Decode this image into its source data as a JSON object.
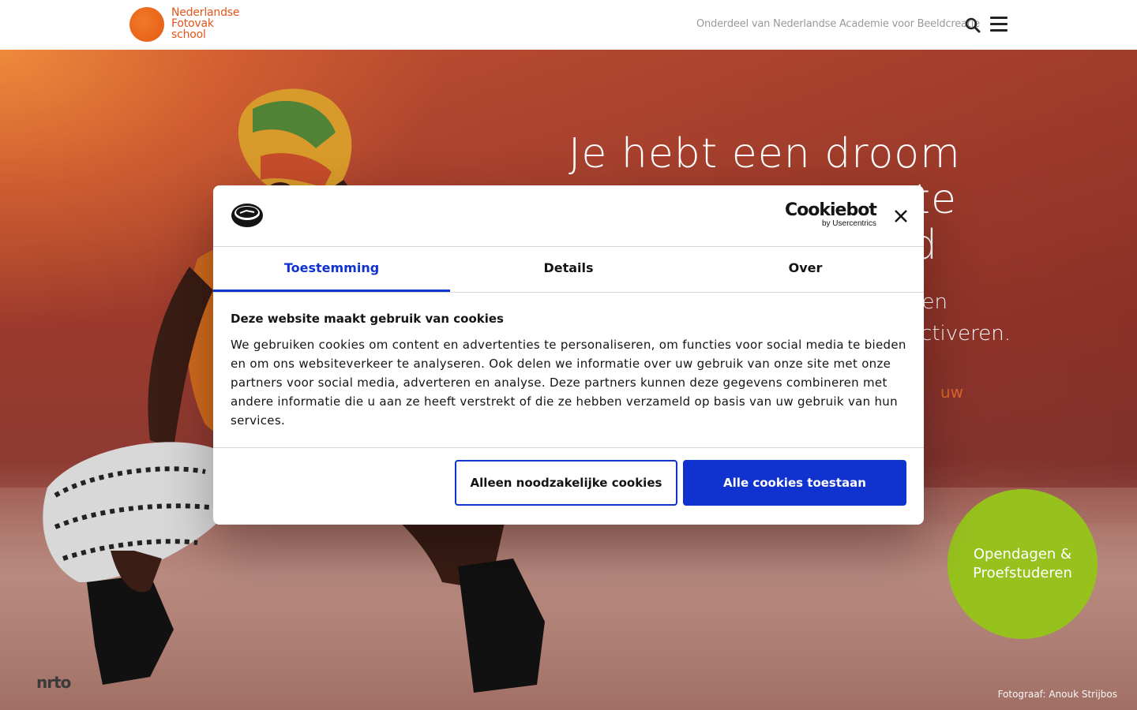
{
  "header": {
    "logo_lines": [
      "Nederlandse",
      "Fotovak",
      "school"
    ],
    "tagline": "Onderdeel van Nederlandse Academie voor Beeldcreatie",
    "search_icon": "search-icon",
    "menu_icon": "hamburger-menu-icon"
  },
  "hero": {
    "title_lines": [
      "Je hebt een droom",
      "te",
      "d"
    ],
    "subtitle_lines": [
      "en",
      "activeren."
    ],
    "link_text": "uw",
    "open_days_lines": [
      "Opendagen &",
      "Proefstuderen"
    ],
    "nrto_label": "nrto",
    "credit": "Fotograaf: Anouk Strijbos"
  },
  "cookie_dialog": {
    "brand": "Cookiebot",
    "brand_sub": "by Usercentrics",
    "tabs": [
      {
        "label": "Toestemming",
        "active": true
      },
      {
        "label": "Details",
        "active": false
      },
      {
        "label": "Over",
        "active": false
      }
    ],
    "heading": "Deze website maakt gebruik van cookies",
    "body": "We gebruiken cookies om content en advertenties te personaliseren, om functies voor social media te bieden en om ons websiteverkeer te analyseren. Ook delen we informatie over uw gebruik van onze site met onze partners voor social media, adverteren en analyse. Deze partners kunnen deze gegevens combineren met andere informatie die u aan ze heeft verstrekt of die ze hebben verzameld op basis van uw gebruik van hun services.",
    "btn_necessary": "Alleen noodzakelijke cookies",
    "btn_all": "Alle cookies toestaan"
  },
  "colors": {
    "brand_orange": "#e2551a",
    "accent_blue": "#1032cf",
    "open_days_green": "#97c21e"
  }
}
